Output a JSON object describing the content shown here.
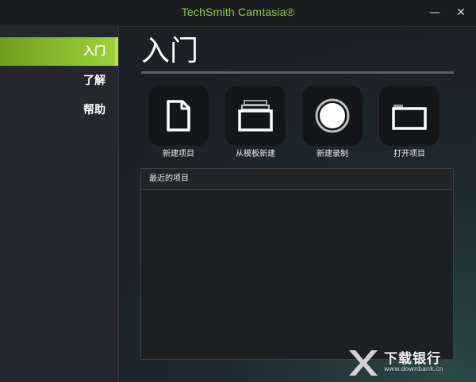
{
  "window": {
    "title": "TechSmith Camtasia®",
    "minimize_glyph": "—",
    "close_glyph": "✕"
  },
  "sidebar": {
    "items": [
      {
        "label": "入门",
        "active": true
      },
      {
        "label": "了解",
        "active": false
      },
      {
        "label": "帮助",
        "active": false
      }
    ]
  },
  "main": {
    "title": "入门",
    "tiles": [
      {
        "label": "新建项目",
        "icon": "document-icon"
      },
      {
        "label": "从模板新建",
        "icon": "template-stack-icon"
      },
      {
        "label": "新建录制",
        "icon": "record-icon"
      },
      {
        "label": "打开项目",
        "icon": "folder-icon"
      }
    ],
    "recent": {
      "title": "最近的项目"
    }
  },
  "watermark": {
    "text": "下载银行",
    "url": "www.downbank.cn"
  },
  "colors": {
    "accent": "#8dc63f",
    "sidebar_bg": "#23282c",
    "tile_bg": "#141719"
  }
}
